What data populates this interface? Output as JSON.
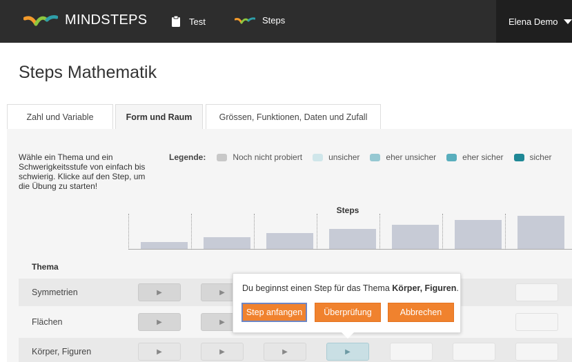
{
  "topbar": {
    "logo_text": "MINDSTEPS",
    "nav_test": "Test",
    "nav_steps": "Steps",
    "user_name": "Elena Demo"
  },
  "page_title": "Steps Mathematik",
  "tabs": [
    {
      "label": "Zahl und Variable",
      "active": false
    },
    {
      "label": "Form und Raum",
      "active": true
    },
    {
      "label": "Grössen, Funktionen, Daten und Zufall",
      "active": false
    }
  ],
  "intro_text": "Wähle ein Thema und ein Schwerigkeitsstufe von einfach bis schwierig. Klicke auf den Step, um die Übung zu starten!",
  "legend": {
    "label": "Legende:",
    "items": [
      {
        "label": "Noch nicht probiert",
        "color": "#c8c8c8"
      },
      {
        "label": "unsicher",
        "color": "#cfe6ea"
      },
      {
        "label": "eher unsicher",
        "color": "#96c8d2"
      },
      {
        "label": "eher sicher",
        "color": "#59aebd"
      },
      {
        "label": "sicher",
        "color": "#1f8896"
      }
    ]
  },
  "steps_header": "Steps",
  "step_bar_levels": [
    1,
    2,
    3,
    4,
    5,
    6,
    7
  ],
  "thema_header": "Thema",
  "rows": [
    {
      "label": "Symmetrien"
    },
    {
      "label": "Flächen"
    },
    {
      "label": "Körper, Figuren"
    }
  ],
  "popover": {
    "message_prefix": "Du beginnst einen Step für das Thema ",
    "topic": "Körper, Figuren",
    "message_suffix": ".",
    "buttons": {
      "start": "Step anfangen",
      "review": "Überprüfung",
      "cancel": "Abbrechen"
    }
  },
  "colors": {
    "topbar": "#2d2d2d",
    "accent_orange": "#f0822e",
    "logo_orange": "#f39a2b",
    "logo_teal": "#2e9ea8"
  }
}
